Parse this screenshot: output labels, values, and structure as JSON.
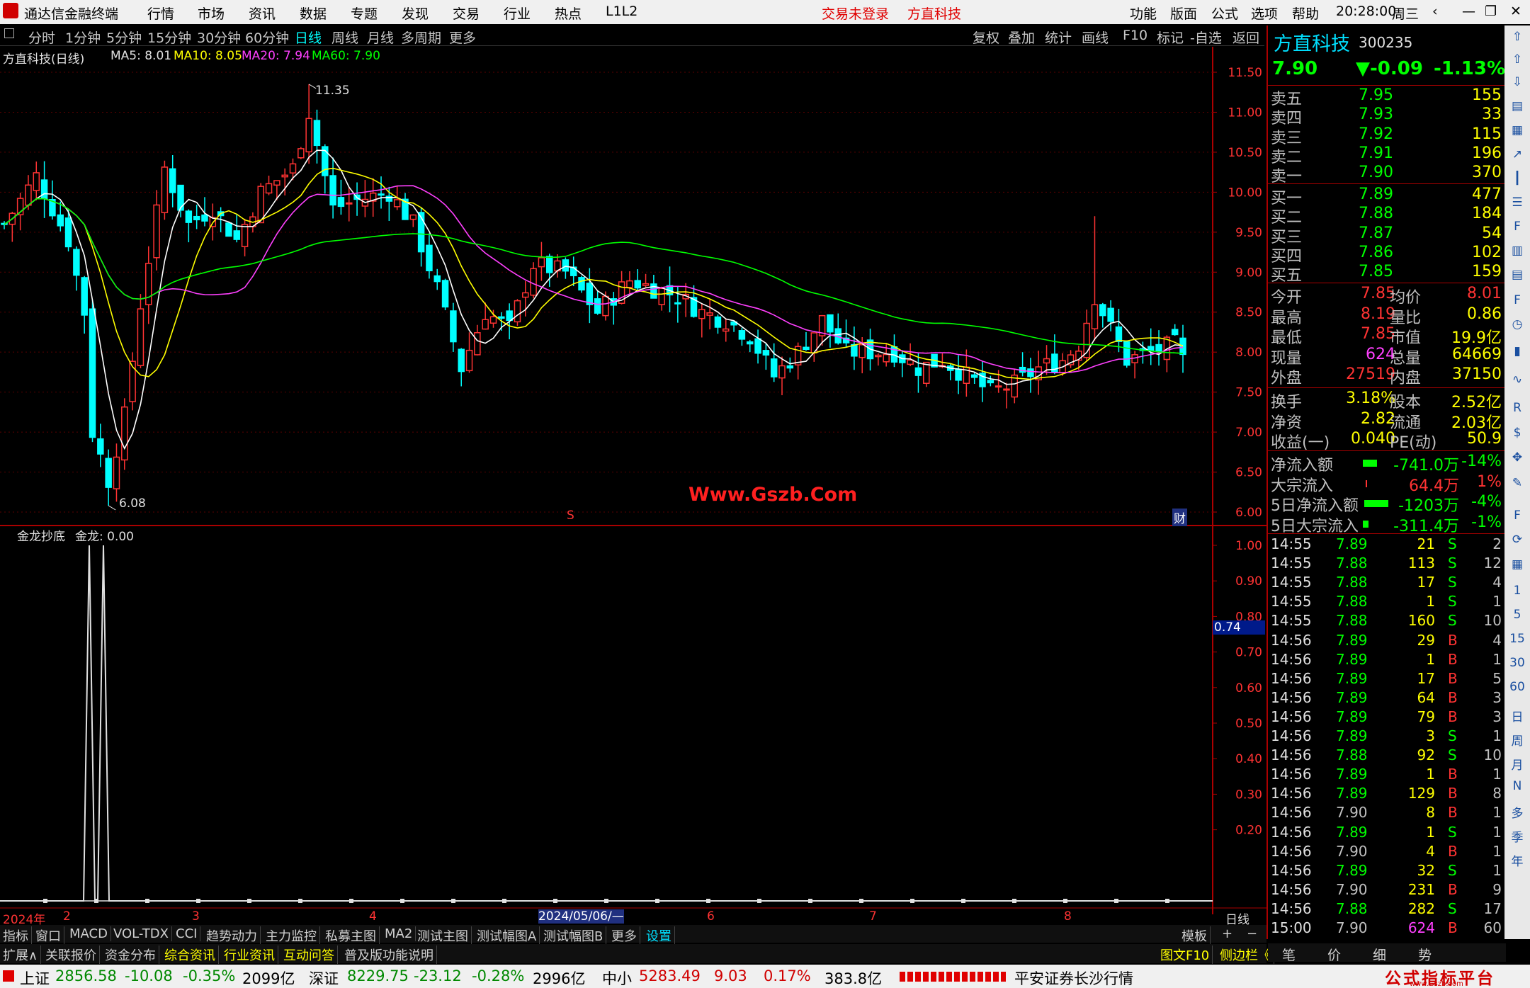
{
  "titlebar": {
    "app_title": "通达信金融终端",
    "menus": [
      "行情",
      "市场",
      "资讯",
      "数据",
      "专题",
      "发现",
      "交易",
      "行业",
      "热点",
      "L1L2"
    ],
    "login_status": "交易未登录",
    "stock_name": "方直科技",
    "right_menus": [
      "功能",
      "版面",
      "公式",
      "选项",
      "帮助"
    ],
    "clock": "20:28:00",
    "weekday": "周三"
  },
  "period_toolbar": {
    "items": [
      "分时",
      "1分钟",
      "5分钟",
      "15分钟",
      "30分钟",
      "60分钟",
      "日线",
      "周线",
      "月线",
      "多周期",
      "更多"
    ],
    "selected": "日线",
    "right_items": [
      "复权",
      "叠加",
      "统计",
      "画线",
      "F10",
      "标记",
      "-自选",
      "返回"
    ]
  },
  "main_chart": {
    "title": "方直科技(日线)",
    "ma5": "MA5: 8.01",
    "ma10": "MA10: 8.05",
    "ma20": "MA20: 7.94",
    "ma60": "MA60: 7.90",
    "high_label": "11.35",
    "low_label": "6.08",
    "watermark": "Www.Gszb.Com",
    "badge": "财",
    "marker": "S",
    "y_ticks": [
      "11.50",
      "11.00",
      "10.50",
      "10.00",
      "9.50",
      "9.00",
      "8.50",
      "8.00",
      "7.50",
      "7.00",
      "6.50",
      "6.00"
    ]
  },
  "indicator": {
    "title": "金龙抄底",
    "value_label": "金龙: 0.00",
    "y_ticks": [
      "1.00",
      "0.90",
      "0.80",
      "0.70",
      "0.60",
      "0.50",
      "0.40",
      "0.30",
      "0.20"
    ],
    "cursor_value": "0.74"
  },
  "xaxis": {
    "labels": [
      "2024年",
      "2",
      "3",
      "4",
      "2024/05/06/—",
      "6",
      "7",
      "8"
    ],
    "period": "日线"
  },
  "chart_data": {
    "type": "candlestick",
    "ma_colors": {
      "MA5": "#ffffff",
      "MA10": "#ffff00",
      "MA20": "#ff40ff",
      "MA60": "#00ff00"
    },
    "ylim": [
      6.0,
      11.5
    ],
    "high": 11.35,
    "low": 6.08,
    "indicator_spikes": [
      1.0,
      1.0
    ],
    "indicator_ylim": [
      0,
      1.0
    ]
  },
  "quote": {
    "name": "方直科技",
    "code": "300235",
    "price": "7.90",
    "change": "▼-0.09",
    "change_pct": "-1.13%",
    "asks": [
      {
        "label": "卖五",
        "price": "7.95",
        "vol": "155"
      },
      {
        "label": "卖四",
        "price": "7.93",
        "vol": "33"
      },
      {
        "label": "卖三",
        "price": "7.92",
        "vol": "115"
      },
      {
        "label": "卖二",
        "price": "7.91",
        "vol": "196"
      },
      {
        "label": "卖一",
        "price": "7.90",
        "vol": "370"
      }
    ],
    "bids": [
      {
        "label": "买一",
        "price": "7.89",
        "vol": "477"
      },
      {
        "label": "买二",
        "price": "7.88",
        "vol": "184"
      },
      {
        "label": "买三",
        "price": "7.87",
        "vol": "54"
      },
      {
        "label": "买四",
        "price": "7.86",
        "vol": "102"
      },
      {
        "label": "买五",
        "price": "7.85",
        "vol": "159"
      }
    ],
    "stats": [
      [
        "今开",
        "7.85",
        "均价",
        "8.01"
      ],
      [
        "最高",
        "8.19",
        "量比",
        "0.86"
      ],
      [
        "最低",
        "7.85",
        "市值",
        "19.9亿"
      ],
      [
        "现量",
        "624",
        "总量",
        "64669"
      ],
      [
        "外盘",
        "27519",
        "内盘",
        "37150"
      ]
    ],
    "stats2": [
      [
        "换手",
        "3.18%",
        "股本",
        "2.52亿"
      ],
      [
        "净资",
        "2.82",
        "流通",
        "2.03亿"
      ],
      [
        "收益(一)",
        "0.040",
        "PE(动)",
        "50.9"
      ]
    ],
    "flows": [
      [
        "净流入额",
        "-741.0万",
        "-14%"
      ],
      [
        "大宗流入",
        "64.4万",
        "1%"
      ],
      [
        "5日净流入额",
        "-1203万",
        "-4%"
      ],
      [
        "5日大宗流入",
        "-311.4万",
        "-1%"
      ]
    ],
    "ticks": [
      [
        "14:55",
        "7.89",
        "21",
        "S",
        "2"
      ],
      [
        "14:55",
        "7.88",
        "113",
        "S",
        "12"
      ],
      [
        "14:55",
        "7.88",
        "17",
        "S",
        "4"
      ],
      [
        "14:55",
        "7.88",
        "1",
        "S",
        "1"
      ],
      [
        "14:55",
        "7.88",
        "160",
        "S",
        "10"
      ],
      [
        "14:56",
        "7.89",
        "29",
        "B",
        "4"
      ],
      [
        "14:56",
        "7.89",
        "1",
        "B",
        "1"
      ],
      [
        "14:56",
        "7.89",
        "17",
        "B",
        "5"
      ],
      [
        "14:56",
        "7.89",
        "64",
        "B",
        "3"
      ],
      [
        "14:56",
        "7.89",
        "79",
        "B",
        "3"
      ],
      [
        "14:56",
        "7.89",
        "3",
        "S",
        "1"
      ],
      [
        "14:56",
        "7.88",
        "92",
        "S",
        "10"
      ],
      [
        "14:56",
        "7.89",
        "1",
        "B",
        "1"
      ],
      [
        "14:56",
        "7.89",
        "129",
        "B",
        "8"
      ],
      [
        "14:56",
        "7.90",
        "8",
        "B",
        "1"
      ],
      [
        "14:56",
        "7.89",
        "1",
        "S",
        "1"
      ],
      [
        "14:56",
        "7.90",
        "4",
        "B",
        "1"
      ],
      [
        "14:56",
        "7.89",
        "32",
        "S",
        "1"
      ],
      [
        "14:56",
        "7.90",
        "231",
        "B",
        "9"
      ],
      [
        "14:56",
        "7.88",
        "282",
        "S",
        "17"
      ],
      [
        "15:00",
        "7.90",
        "624",
        "B",
        "60"
      ]
    ]
  },
  "bottom_tabs1": [
    "指标",
    "窗口",
    "MACD",
    "VOL-TDX",
    "CCI",
    "趋势动力",
    "主力监控",
    "私募主图",
    "MA2",
    "测试主图",
    "测试幅图A",
    "测试幅图B",
    "更多",
    "设置"
  ],
  "bottom_tabs1_right": "模板",
  "bottom_tabs2": [
    "扩展∧",
    "关联报价",
    "资金分布",
    "综合资讯",
    "行业资讯",
    "互动问答",
    "普及版功能说明"
  ],
  "bottom_tabs2_right": [
    "图文F10",
    "侧边栏《"
  ],
  "bottom_right_tabs": [
    "笔",
    "价",
    "细",
    "势"
  ],
  "statusbar": {
    "sh_label": "上证",
    "sh_val": "2856.58",
    "sh_chg": "-10.08",
    "sh_pct": "-0.35%",
    "sh_amt": "2099亿",
    "sz_label": "深证",
    "sz_val": "8229.75",
    "sz_chg": "-23.12",
    "sz_pct": "-0.28%",
    "sz_amt": "2996亿",
    "zx_label": "中小",
    "zx_val": "5283.49",
    "zx_chg": "9.03",
    "zx_pct": "0.17%",
    "zx_amt": "383.8亿",
    "broker": "平安证券长沙行情",
    "brand": "公式指标平台",
    "brand_url": "www.Gszb.com"
  },
  "sidebar_icons": [
    "1",
    "5",
    "15",
    "30",
    "60",
    "日",
    "周",
    "月",
    "N",
    "多",
    "季",
    "年"
  ]
}
